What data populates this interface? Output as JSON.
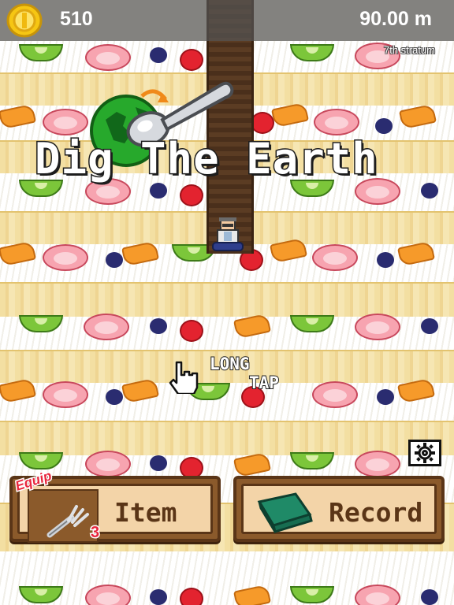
{
  "hud": {
    "coins": "510",
    "depth": "90.00 m",
    "stratum": "7th stratum",
    "coin_icon": "gold-coin-icon"
  },
  "title": "Dig The Earth",
  "hint": {
    "line1": "LONG",
    "line2": "TAP",
    "icon": "pointing-hand-icon"
  },
  "settings": {
    "icon": "gear-icon"
  },
  "buttons": {
    "item": {
      "label": "Item",
      "equip_tag": "Equip",
      "equip_count": "3",
      "icon": "fork-icon"
    },
    "record": {
      "label": "Record",
      "icon": "green-book-icon"
    }
  },
  "colors": {
    "sponge": "#f3dfa2",
    "cream": "#ffffff",
    "tunnel": "#4a2f1b",
    "button_wood": "#8b5a2b",
    "button_face": "#f3d4a8",
    "accent_red": "#e8253c"
  }
}
